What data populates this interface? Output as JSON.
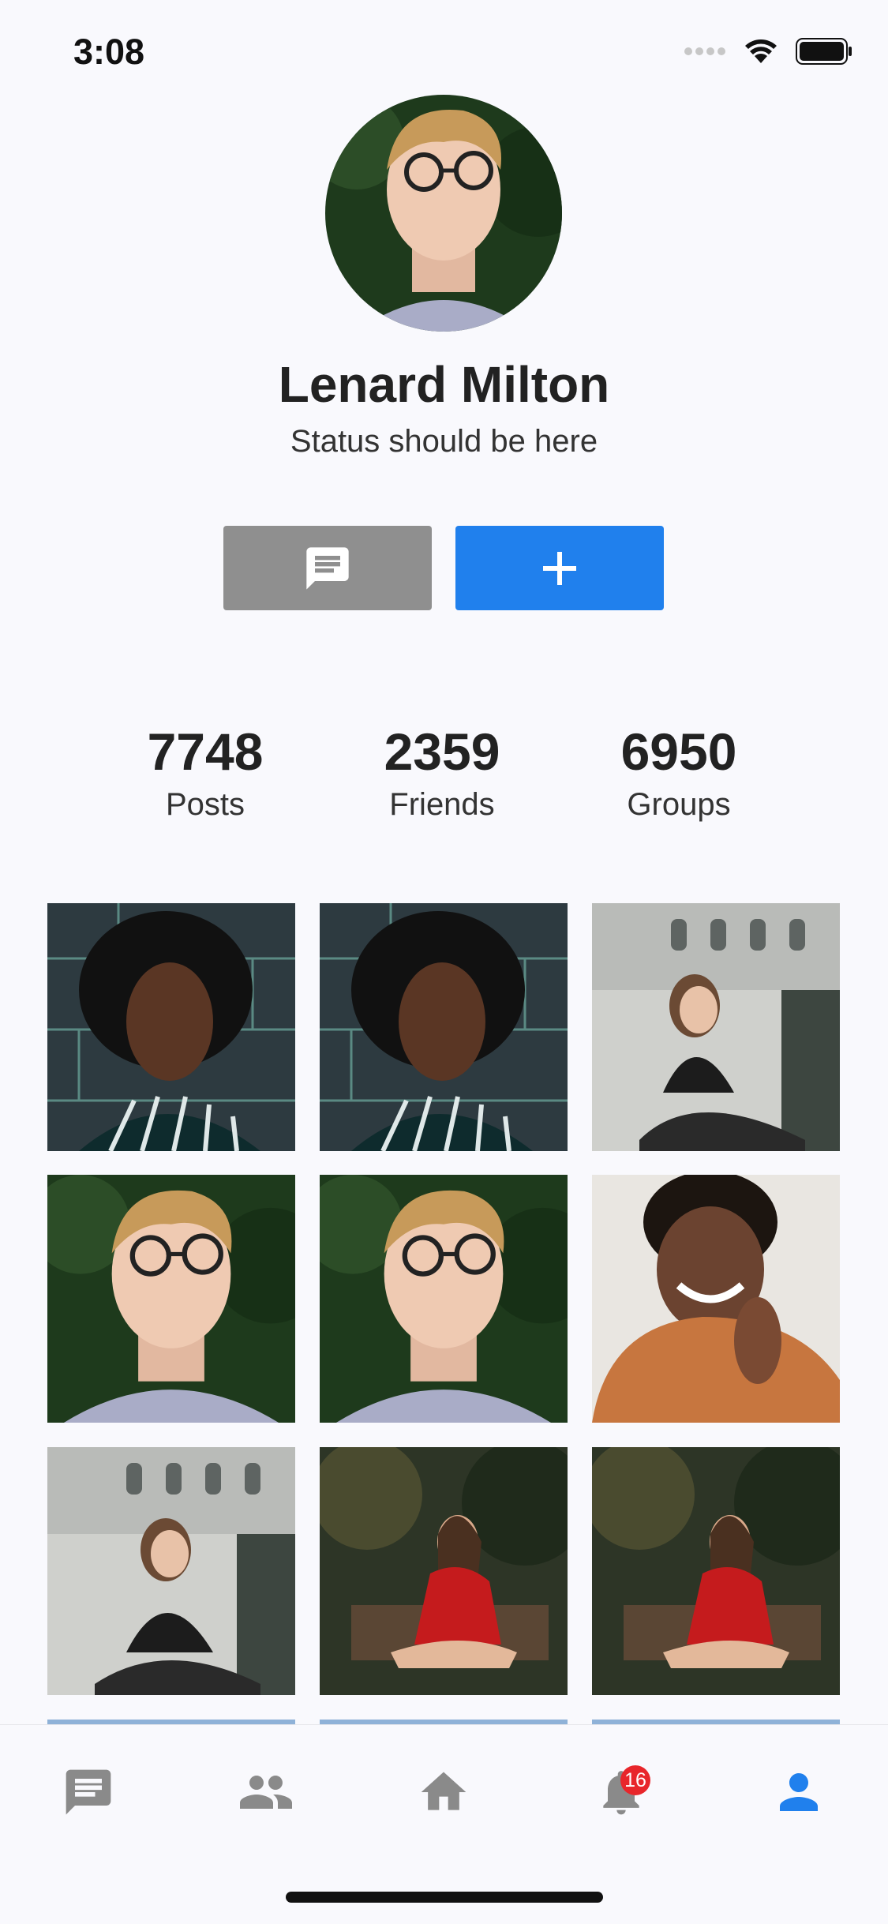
{
  "status_bar": {
    "time": "3:08"
  },
  "profile": {
    "name": "Lenard Milton",
    "status": "Status should be here"
  },
  "actions": {
    "message_icon": "message-icon",
    "add_icon": "plus-icon",
    "message_color": "#8f8f8f",
    "add_color": "#2080ed"
  },
  "stats": [
    {
      "value": "7748",
      "label": "Posts"
    },
    {
      "value": "2359",
      "label": "Friends"
    },
    {
      "value": "6950",
      "label": "Groups"
    }
  ],
  "photos": [
    "woman-curly-hair-brick-wall",
    "woman-curly-hair-brick-wall",
    "woman-sitting-near-train",
    "man-with-glasses",
    "man-with-glasses",
    "woman-orange-sweater",
    "woman-sitting-near-train",
    "woman-red-dress-garden",
    "woman-red-dress-garden"
  ],
  "tab_bar": {
    "tabs": [
      {
        "name": "chat-icon"
      },
      {
        "name": "people-icon"
      },
      {
        "name": "home-icon"
      },
      {
        "name": "bell-icon"
      },
      {
        "name": "person-icon"
      }
    ],
    "notification_count": "16",
    "active_color": "#2080ed",
    "inactive_color": "#8a8a8a"
  }
}
